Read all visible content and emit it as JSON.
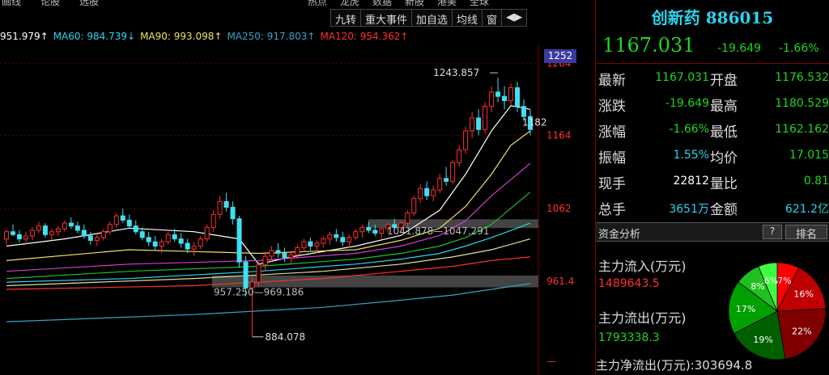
{
  "topbar": [
    "画线",
    "论股",
    "选股",
    "",
    "",
    "",
    "热点",
    "龙虎",
    "数据",
    "新股",
    "港美",
    "全球"
  ],
  "toolbar": [
    "九转",
    "重大事件",
    "加自选",
    "均线",
    "窗",
    "◀▶"
  ],
  "ma": [
    {
      "label": "951.979↑",
      "color": "#ffffff"
    },
    {
      "label": "MA60: 984.739↓",
      "color": "#2ad4f0"
    },
    {
      "label": "MA90: 993.098↑",
      "color": "#f0e060"
    },
    {
      "label": "MA250: 917.803↑",
      "color": "#3aa0c8"
    },
    {
      "label": "MA120: 954.362↑",
      "color": "#ff3030"
    }
  ],
  "chart_data": {
    "type": "candlestick",
    "ylabels": [
      "1264",
      "1164",
      "1062",
      "961.4",
      "—"
    ],
    "current_tag": "1252",
    "annotations": {
      "high": "1243.857",
      "low": "884.078",
      "right_mark": "1182",
      "gap1": "1041.878—1047.291",
      "gap2": "957.250—969.186"
    },
    "candles": [
      [
        1,
        1020,
        1034,
        1012,
        1030
      ],
      [
        2,
        1030,
        1040,
        1024,
        1026
      ],
      [
        3,
        1026,
        1032,
        1015,
        1020
      ],
      [
        4,
        1020,
        1030,
        1012,
        1024
      ],
      [
        5,
        1024,
        1036,
        1018,
        1032
      ],
      [
        6,
        1032,
        1044,
        1028,
        1038
      ],
      [
        7,
        1038,
        1042,
        1022,
        1026
      ],
      [
        8,
        1026,
        1034,
        1018,
        1030
      ],
      [
        9,
        1030,
        1038,
        1024,
        1034
      ],
      [
        10,
        1034,
        1046,
        1030,
        1042
      ],
      [
        11,
        1042,
        1050,
        1034,
        1038
      ],
      [
        12,
        1038,
        1044,
        1028,
        1032
      ],
      [
        13,
        1032,
        1040,
        1020,
        1024
      ],
      [
        14,
        1024,
        1030,
        1012,
        1018
      ],
      [
        15,
        1018,
        1026,
        1010,
        1022
      ],
      [
        16,
        1022,
        1034,
        1018,
        1030
      ],
      [
        17,
        1030,
        1044,
        1026,
        1040
      ],
      [
        18,
        1040,
        1056,
        1036,
        1052
      ],
      [
        19,
        1052,
        1062,
        1042,
        1046
      ],
      [
        20,
        1046,
        1054,
        1034,
        1038
      ],
      [
        21,
        1038,
        1046,
        1026,
        1030
      ],
      [
        22,
        1030,
        1036,
        1018,
        1022
      ],
      [
        23,
        1022,
        1030,
        1010,
        1016
      ],
      [
        24,
        1016,
        1024,
        1004,
        1010
      ],
      [
        25,
        1010,
        1020,
        1000,
        1016
      ],
      [
        26,
        1016,
        1030,
        1012,
        1026
      ],
      [
        27,
        1026,
        1034,
        1016,
        1020
      ],
      [
        28,
        1020,
        1028,
        1008,
        1014
      ],
      [
        29,
        1014,
        1020,
        1000,
        1006
      ],
      [
        30,
        1006,
        1016,
        996,
        1010
      ],
      [
        31,
        1010,
        1024,
        1006,
        1020
      ],
      [
        32,
        1020,
        1040,
        1016,
        1036
      ],
      [
        33,
        1036,
        1060,
        1030,
        1054
      ],
      [
        34,
        1054,
        1080,
        1048,
        1072
      ],
      [
        35,
        1072,
        1084,
        1058,
        1064
      ],
      [
        36,
        1064,
        1072,
        1040,
        1048
      ],
      [
        37,
        1048,
        1052,
        980,
        988
      ],
      [
        38,
        988,
        996,
        940,
        952
      ],
      [
        39,
        952,
        966,
        884,
        960
      ],
      [
        40,
        960,
        988,
        954,
        984
      ],
      [
        41,
        984,
        1002,
        976,
        996
      ],
      [
        42,
        996,
        1010,
        988,
        1004
      ],
      [
        43,
        1004,
        1014,
        994,
        1000
      ],
      [
        44,
        1000,
        1008,
        988,
        994
      ],
      [
        45,
        994,
        1004,
        984,
        998
      ],
      [
        46,
        998,
        1012,
        992,
        1008
      ],
      [
        47,
        1008,
        1020,
        1002,
        1016
      ],
      [
        48,
        1016,
        1022,
        1004,
        1010
      ],
      [
        49,
        1010,
        1018,
        1000,
        1014
      ],
      [
        50,
        1014,
        1024,
        1008,
        1020
      ],
      [
        51,
        1020,
        1030,
        1012,
        1026
      ],
      [
        52,
        1026,
        1034,
        1016,
        1022
      ],
      [
        53,
        1022,
        1030,
        1010,
        1016
      ],
      [
        54,
        1016,
        1026,
        1008,
        1022
      ],
      [
        55,
        1022,
        1034,
        1018,
        1030
      ],
      [
        56,
        1030,
        1040,
        1022,
        1036
      ],
      [
        57,
        1036,
        1044,
        1028,
        1032
      ],
      [
        58,
        1032,
        1040,
        1024,
        1028
      ],
      [
        59,
        1028,
        1036,
        1020,
        1034
      ],
      [
        60,
        1034,
        1042,
        1028,
        1040
      ],
      [
        61,
        1040,
        1048,
        1032,
        1036
      ],
      [
        62,
        1036,
        1044,
        1028,
        1042
      ],
      [
        63,
        1042,
        1060,
        1038,
        1056
      ],
      [
        64,
        1056,
        1080,
        1052,
        1076
      ],
      [
        65,
        1076,
        1096,
        1070,
        1090
      ],
      [
        66,
        1090,
        1100,
        1074,
        1080
      ],
      [
        67,
        1080,
        1094,
        1072,
        1088
      ],
      [
        68,
        1088,
        1110,
        1084,
        1104
      ],
      [
        69,
        1104,
        1120,
        1094,
        1100
      ],
      [
        70,
        1100,
        1130,
        1096,
        1126
      ],
      [
        71,
        1126,
        1150,
        1120,
        1144
      ],
      [
        72,
        1144,
        1176,
        1138,
        1170
      ],
      [
        73,
        1170,
        1196,
        1160,
        1188
      ],
      [
        74,
        1188,
        1200,
        1164,
        1172
      ],
      [
        75,
        1172,
        1210,
        1166,
        1204
      ],
      [
        76,
        1204,
        1232,
        1196,
        1224
      ],
      [
        77,
        1224,
        1244,
        1210,
        1218
      ],
      [
        78,
        1218,
        1232,
        1200,
        1212
      ],
      [
        79,
        1212,
        1236,
        1206,
        1230
      ],
      [
        80,
        1230,
        1238,
        1196,
        1204
      ],
      [
        81,
        1204,
        1214,
        1184,
        1190
      ],
      [
        82,
        1190,
        1200,
        1164,
        1172
      ]
    ],
    "series": [
      {
        "color": "#ffffff",
        "points": [
          [
            1,
            1010
          ],
          [
            10,
            1020
          ],
          [
            20,
            1035
          ],
          [
            30,
            1030
          ],
          [
            37,
            1020
          ],
          [
            40,
            985
          ],
          [
            45,
            995
          ],
          [
            55,
            1010
          ],
          [
            62,
            1025
          ],
          [
            68,
            1060
          ],
          [
            72,
            1110
          ],
          [
            76,
            1170
          ],
          [
            79,
            1205
          ],
          [
            82,
            1200
          ]
        ]
      },
      {
        "color": "#f0e060",
        "points": [
          [
            1,
            990
          ],
          [
            20,
            1005
          ],
          [
            40,
            1000
          ],
          [
            55,
            1005
          ],
          [
            62,
            1018
          ],
          [
            68,
            1035
          ],
          [
            72,
            1065
          ],
          [
            76,
            1110
          ],
          [
            79,
            1150
          ],
          [
            82,
            1170
          ]
        ]
      },
      {
        "color": "#d040d0",
        "points": [
          [
            1,
            975
          ],
          [
            20,
            985
          ],
          [
            40,
            990
          ],
          [
            55,
            1000
          ],
          [
            62,
            1010
          ],
          [
            68,
            1025
          ],
          [
            72,
            1045
          ],
          [
            76,
            1080
          ],
          [
            80,
            1110
          ],
          [
            82,
            1125
          ]
        ]
      },
      {
        "color": "#20c020",
        "points": [
          [
            1,
            965
          ],
          [
            20,
            975
          ],
          [
            40,
            982
          ],
          [
            55,
            992
          ],
          [
            62,
            1000
          ],
          [
            68,
            1010
          ],
          [
            72,
            1022
          ],
          [
            76,
            1040
          ],
          [
            80,
            1070
          ],
          [
            82,
            1085
          ]
        ]
      },
      {
        "color": "#2ad4f0",
        "points": [
          [
            1,
            960
          ],
          [
            20,
            965
          ],
          [
            40,
            975
          ],
          [
            55,
            985
          ],
          [
            62,
            992
          ],
          [
            68,
            1000
          ],
          [
            72,
            1010
          ],
          [
            76,
            1022
          ],
          [
            80,
            1035
          ],
          [
            82,
            1042
          ]
        ]
      },
      {
        "color": "#e0e0a0",
        "points": [
          [
            1,
            955
          ],
          [
            30,
            965
          ],
          [
            50,
            975
          ],
          [
            62,
            985
          ],
          [
            70,
            995
          ],
          [
            76,
            1005
          ],
          [
            80,
            1015
          ],
          [
            82,
            1020
          ]
        ]
      },
      {
        "color": "#ff3030",
        "points": [
          [
            1,
            950
          ],
          [
            30,
            955
          ],
          [
            50,
            965
          ],
          [
            62,
            975
          ],
          [
            70,
            982
          ],
          [
            76,
            990
          ],
          [
            82,
            995
          ]
        ]
      },
      {
        "color": "#3aa0c8",
        "points": [
          [
            1,
            905
          ],
          [
            30,
            915
          ],
          [
            50,
            925
          ],
          [
            62,
            935
          ],
          [
            70,
            942
          ],
          [
            76,
            950
          ],
          [
            82,
            958
          ]
        ]
      }
    ]
  },
  "panel": {
    "name": "创新药",
    "code": "886015",
    "price": "1167.031",
    "change": "-19.649",
    "pct": "-1.66%",
    "rows": [
      {
        "l1": "最新",
        "v1": "1167.031",
        "c1": "green",
        "l2": "开盘",
        "v2": "1176.532",
        "c2": "green"
      },
      {
        "l1": "涨跌",
        "v1": "-19.649",
        "c1": "green",
        "l2": "最高",
        "v2": "1180.529",
        "c2": "green"
      },
      {
        "l1": "涨幅",
        "v1": "-1.66%",
        "c1": "green",
        "l2": "最低",
        "v2": "1162.162",
        "c2": "green"
      },
      {
        "l1": "振幅",
        "v1": "1.55%",
        "c1": "cyan",
        "l2": "均价",
        "v2": "17.015",
        "c2": "green"
      },
      {
        "l1": "现手",
        "v1": "22812",
        "c1": "white",
        "l2": "量比",
        "v2": "0.81",
        "c2": "green"
      },
      {
        "l1": "总手",
        "v1": "3651万",
        "c1": "cyan",
        "l2": "金额",
        "v2": "621.2亿",
        "c2": "cyan"
      }
    ],
    "section_title": "资金分析",
    "help": "?",
    "rank": "排名",
    "inflow_label": "主力流入(万元)",
    "inflow_value": "1489643.5",
    "outflow_label": "主力流出(万元)",
    "outflow_value": "1793338.3",
    "net_label": "主力净流出(万元):",
    "net_value": "303694.8",
    "pie": [
      {
        "label": "7%",
        "value": 7,
        "color": "#ff0000"
      },
      {
        "label": "16%",
        "value": 16,
        "color": "#c00000"
      },
      {
        "label": "22%",
        "value": 22,
        "color": "#800000"
      },
      {
        "label": "19%",
        "value": 19,
        "color": "#006000"
      },
      {
        "label": "17%",
        "value": 17,
        "color": "#00a000"
      },
      {
        "label": "8%",
        "value": 8,
        "color": "#20c020"
      },
      {
        "label": "6%",
        "value": 6,
        "color": "#40ff40"
      }
    ]
  }
}
